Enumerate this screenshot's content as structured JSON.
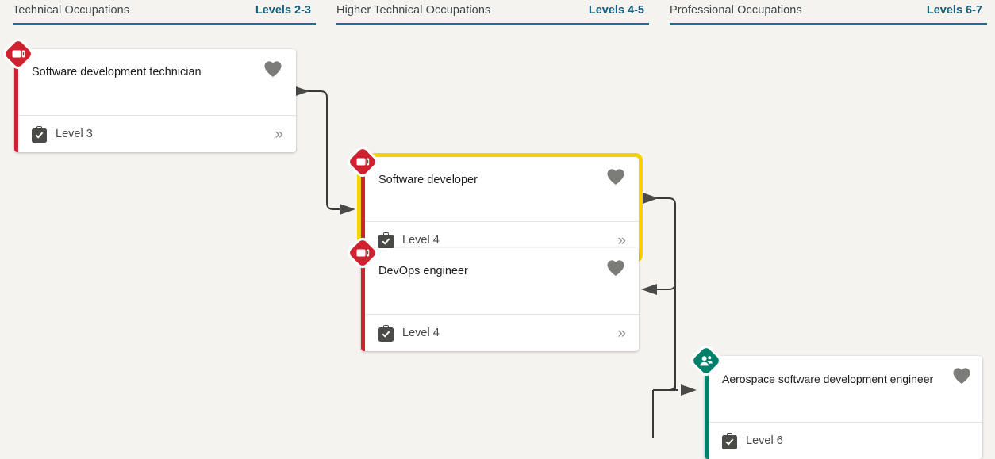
{
  "columns": [
    {
      "title": "Technical Occupations",
      "levels": "Levels 2-3"
    },
    {
      "title": "Higher Technical Occupations",
      "levels": "Levels 4-5"
    },
    {
      "title": "Professional Occupations",
      "levels": "Levels 6-7"
    }
  ],
  "cards": [
    {
      "id": "software-development-technician",
      "title": "Software development technician",
      "level": "Level 3",
      "badge_type": "apprenticeship",
      "badge_color": "#cf2130",
      "stripe_color": "#cf2130",
      "highlighted": false,
      "favourite_icon": "heart-icon",
      "level_icon": "clipboard-check-icon",
      "expand_icon": "chevron-double-right-icon"
    },
    {
      "id": "software-developer",
      "title": "Software developer",
      "level": "Level 4",
      "badge_type": "apprenticeship",
      "badge_color": "#cf2130",
      "stripe_color": "#cf2130",
      "highlighted": true,
      "highlight_color": "#f2d200",
      "favourite_icon": "heart-icon",
      "level_icon": "clipboard-check-icon",
      "expand_icon": "chevron-double-right-icon"
    },
    {
      "id": "devops-engineer",
      "title": "DevOps engineer",
      "level": "Level 4",
      "badge_type": "apprenticeship",
      "badge_color": "#cf2130",
      "stripe_color": "#cf2130",
      "highlighted": false,
      "favourite_icon": "heart-icon",
      "level_icon": "clipboard-check-icon",
      "expand_icon": "chevron-double-right-icon"
    },
    {
      "id": "aerospace-software-development-engineer",
      "title": "Aerospace software development engineer",
      "level": "Level 6",
      "badge_type": "degree-apprenticeship",
      "badge_color": "#00806a",
      "stripe_color": "#00806a",
      "highlighted": false,
      "favourite_icon": "heart-icon",
      "level_icon": "clipboard-check-icon",
      "expand_icon": null
    }
  ],
  "theme": {
    "background": "#f5f3ef",
    "header_rule": "#1b6e8c",
    "header_link": "#15607e",
    "header_title": "#3d4548",
    "connector": "#3a3a38",
    "card_background": "#ffffff",
    "icon_gray": "#7b7b79"
  }
}
